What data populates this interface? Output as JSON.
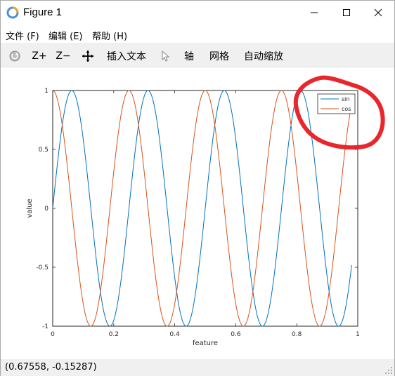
{
  "window": {
    "title": "Figure 1"
  },
  "menu": [
    {
      "label": "文件 (F)"
    },
    {
      "label": "编辑 (E)"
    },
    {
      "label": "帮助 (H)"
    }
  ],
  "toolbar": {
    "zoom_in": "Z+",
    "zoom_out": "Z−",
    "insert_text": "插入文本",
    "axis": "轴",
    "grid": "网格",
    "autoscale": "自动缩放"
  },
  "status": {
    "coords": "(0.67558, -0.15287)"
  },
  "colors": {
    "sin": "#0072bd",
    "cos": "#d95319",
    "annotation": "#e8262b",
    "toolbar_bg": "#f0f0f0"
  },
  "chart_data": {
    "type": "line",
    "xlabel": "feature",
    "ylabel": "value",
    "xlim": [
      0,
      1
    ],
    "ylim": [
      -1,
      1
    ],
    "x_ticks": [
      "0",
      "0.2",
      "0.4",
      "0.6",
      "0.8",
      "1"
    ],
    "y_ticks": [
      "-1",
      "-0.5",
      "0",
      "0.5",
      "1"
    ],
    "x_tick_values": [
      0,
      0.2,
      0.4,
      0.6,
      0.8,
      1
    ],
    "y_tick_values": [
      -1,
      -0.5,
      0,
      0.5,
      1
    ],
    "x_range": [
      0,
      0.98
    ],
    "frequency_cycles_per_unit": 4,
    "series": [
      {
        "name": "sin",
        "function": "sin(2*pi*4*x)",
        "color": "#0072bd"
      },
      {
        "name": "cos",
        "function": "cos(2*pi*4*x)",
        "color": "#d95319"
      }
    ],
    "legend_position": "top-right",
    "grid": false
  }
}
